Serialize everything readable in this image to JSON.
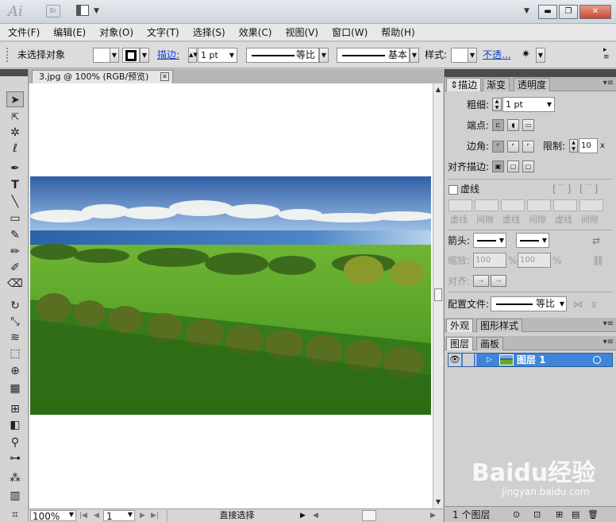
{
  "app": {
    "logo": "Ai",
    "bridge_logo": "Br"
  },
  "menu": [
    "文件(F)",
    "编辑(E)",
    "对象(O)",
    "文字(T)",
    "选择(S)",
    "效果(C)",
    "视图(V)",
    "窗口(W)",
    "帮助(H)"
  ],
  "control": {
    "no_selection": "未选择对象",
    "stroke_label": "描边:",
    "stroke_weight": "1 pt",
    "profile": "等比",
    "brush": "基本",
    "style_label": "样式:",
    "opacity_link": "不透..."
  },
  "document": {
    "tab_title": "3.jpg @ 100% (RGB/预览)"
  },
  "status": {
    "zoom": "100%",
    "artboard": "1",
    "tool": "直接选择"
  },
  "stroke_panel": {
    "tabs": [
      "描边",
      "渐变",
      "透明度"
    ],
    "weight_label": "粗细:",
    "weight_value": "1 pt",
    "cap_label": "端点:",
    "corner_label": "边角:",
    "limit_label": "限制:",
    "limit_value": "10",
    "limit_unit": "x",
    "align_label": "对齐描边:",
    "dashed_label": "虚线",
    "dash_labels": [
      "虚线",
      "间隙",
      "虚线",
      "间隙",
      "虚线",
      "间隙"
    ],
    "arrowheads_label": "箭头:",
    "scale_label": "缩放:",
    "scale_1": "100",
    "scale_2": "100",
    "percent": "%",
    "align_arrow_label": "对齐:",
    "profile_label": "配置文件:",
    "profile_value": "等比"
  },
  "appearance_panel": {
    "tabs": [
      "外观",
      "图形样式"
    ]
  },
  "layers_panel": {
    "tabs": [
      "图层",
      "画板"
    ],
    "layer_name": "图层 1",
    "footer_count": "1 个图层"
  },
  "watermark": {
    "text": "Baidu经验",
    "sub": "jingyan.baidu.com"
  },
  "colors": {
    "accent": "#3f86d8",
    "link": "#1240c8"
  }
}
